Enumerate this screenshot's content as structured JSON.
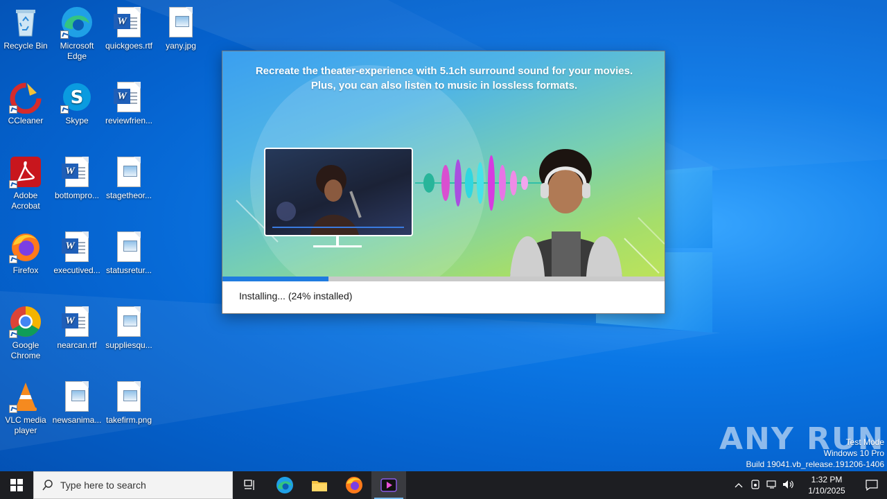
{
  "desktop": {
    "icons": [
      {
        "label": "Recycle Bin",
        "icon": "recycle-bin-icon"
      },
      {
        "label": "Microsoft Edge",
        "icon": "edge-icon"
      },
      {
        "label": "quickgoes.rtf",
        "icon": "word-document-icon"
      },
      {
        "label": "yany.jpg",
        "icon": "image-file-icon"
      },
      {
        "label": "CCleaner",
        "icon": "ccleaner-icon"
      },
      {
        "label": "Skype",
        "icon": "skype-icon"
      },
      {
        "label": "reviewfrien...",
        "icon": "word-document-icon"
      },
      {
        "label": "Adobe Acrobat",
        "icon": "acrobat-icon"
      },
      {
        "label": "bottompro...",
        "icon": "word-document-icon"
      },
      {
        "label": "stagetheor...",
        "icon": "image-file-icon"
      },
      {
        "label": "Firefox",
        "icon": "firefox-icon"
      },
      {
        "label": "executived...",
        "icon": "word-document-icon"
      },
      {
        "label": "statusretur...",
        "icon": "image-file-icon"
      },
      {
        "label": "Google Chrome",
        "icon": "chrome-icon"
      },
      {
        "label": "nearcan.rtf",
        "icon": "word-document-icon"
      },
      {
        "label": "suppliesqu...",
        "icon": "image-file-icon"
      },
      {
        "label": "VLC media player",
        "icon": "vlc-icon"
      },
      {
        "label": "newsanima...",
        "icon": "image-file-icon"
      },
      {
        "label": "takefirm.png",
        "icon": "image-file-icon"
      }
    ]
  },
  "installer": {
    "banner_text": "Recreate the theater-experience with 5.1ch surround sound for your movies. Plus, you can also listen to music in lossless formats.",
    "progress_fraction": 0.24,
    "status": "Installing... (24% installed)"
  },
  "watermark": {
    "brand": "ANY RUN",
    "line1": "Test Mode",
    "line2": "Windows 10 Pro",
    "line3": "Build 19041.vb_release.191206-1406"
  },
  "taskbar": {
    "search_placeholder": "Type here to search",
    "time": "1:32 PM",
    "date": "1/10/2025",
    "accent": "#76b9ed"
  }
}
